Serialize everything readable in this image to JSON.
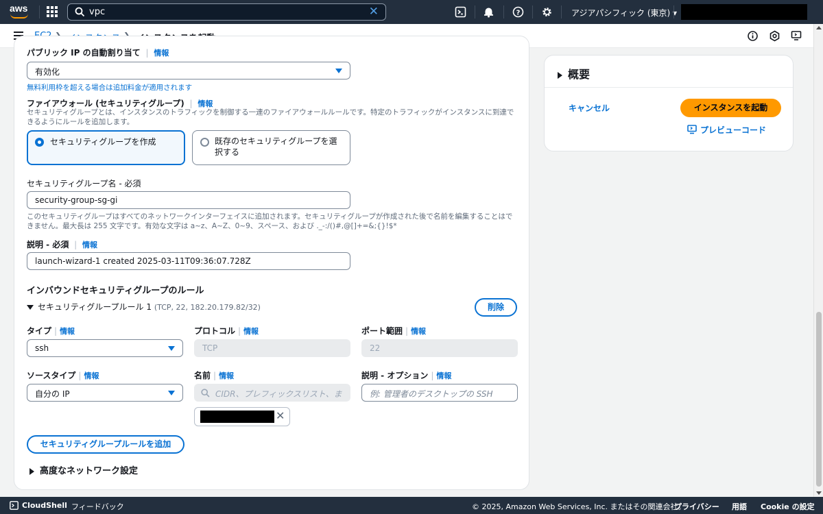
{
  "topbar": {
    "logo_text": "aws",
    "search_value": "vpc",
    "region_label": "アジアパシフィック (東京) ▾"
  },
  "breadcrumb": {
    "items": [
      "EC2",
      "インスタンス",
      "インスタンスを起動"
    ]
  },
  "network": {
    "public_ip_label": "パブリック IP の自動割り当て",
    "public_ip_info": "情報",
    "public_ip_value": "有効化",
    "public_ip_note_prefix": "無料利用枠を超える場合は",
    "public_ip_note_link": "追加料金",
    "public_ip_note_suffix": "が適用されます",
    "firewall_label": "ファイアウォール (セキュリティグループ)",
    "firewall_info": "情報",
    "firewall_desc": "セキュリティグループとは、インスタンスのトラフィックを制御する一連のファイアウォールルールです。特定のトラフィックがインスタンスに到達できるようにルールを追加します。",
    "tile_create": "セキュリティグループを作成",
    "tile_existing": "既存のセキュリティグループを選択する",
    "sg_name_label": "セキュリティグループ名 - 必須",
    "sg_name_value": "security-group-sg-gi",
    "sg_name_desc": "このセキュリティグループはすべてのネットワークインターフェイスに追加されます。セキュリティグループが作成された後で名前を編集することはできません。最大長は 255 文字です。有効な文字は a~z、A~Z、0~9、スペース、および ._-:/()#,@[]+=&;{}!$*",
    "desc_label": "説明 - 必須",
    "desc_info": "情報",
    "desc_value": "launch-wizard-1 created 2025-03-11T09:36:07.728Z",
    "inbound_title": "インバウンドセキュリティグループのルール",
    "rule_title": "セキュリティグループルール 1",
    "rule_detail": "(TCP, 22, 182.20.179.82/32)",
    "delete_label": "削除",
    "type_label": "タイプ",
    "type_info": "情報",
    "type_value": "ssh",
    "protocol_label": "プロトコル",
    "protocol_info": "情報",
    "protocol_value": "TCP",
    "port_label": "ポート範囲",
    "port_info": "情報",
    "port_value": "22",
    "source_type_label": "ソースタイプ",
    "source_type_info": "情報",
    "source_type_value": "自分の IP",
    "name_label": "名前",
    "name_info": "情報",
    "name_placeholder": "CIDR、プレフィックスリスト、ま",
    "optional_desc_label": "説明 - オプション",
    "optional_desc_info": "情報",
    "optional_desc_placeholder": "例: 管理者のデスクトップの SSH",
    "add_rule_label": "セキュリティグループルールを追加",
    "advanced_label": "高度なネットワーク設定"
  },
  "summary": {
    "title": "概要",
    "cancel_label": "キャンセル",
    "launch_label": "インスタンスを起動",
    "preview_label": "プレビューコード"
  },
  "footer": {
    "cloudshell": "CloudShell",
    "feedback": "フィードバック",
    "copyright": "© 2025, Amazon Web Services, Inc. またはその関連会社。",
    "privacy": "プライバシー",
    "terms": "用語",
    "cookie": "Cookie の設定"
  },
  "colors": {
    "accent": "#0972d3",
    "primary_button": "#ff9900",
    "topbar": "#232f3e"
  }
}
